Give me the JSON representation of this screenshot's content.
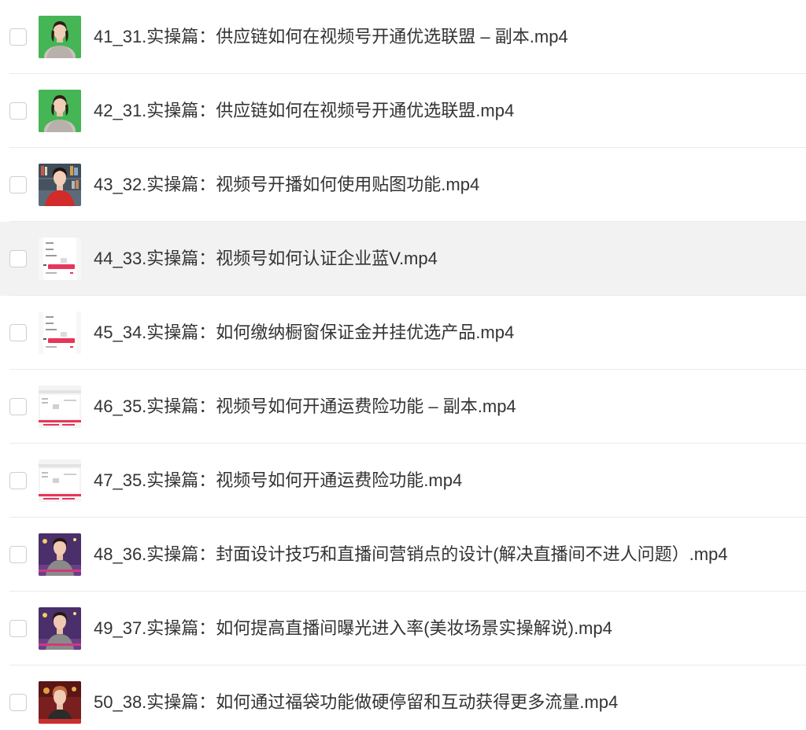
{
  "files": [
    {
      "name": "41_31.实操篇：供应链如何在视频号开通优选联盟 – 副本.mp4",
      "thumbnail": "video-thumbnail-presenter-greenscreen",
      "selected": false
    },
    {
      "name": "42_31.实操篇：供应链如何在视频号开通优选联盟.mp4",
      "thumbnail": "video-thumbnail-presenter-greenscreen",
      "selected": false
    },
    {
      "name": "43_32.实操篇：视频号开播如何使用贴图功能.mp4",
      "thumbnail": "video-thumbnail-presenter-bookshelf",
      "selected": false
    },
    {
      "name": "44_33.实操篇：视频号如何认证企业蓝V.mp4",
      "thumbnail": "video-thumbnail-phone-screen",
      "selected": false,
      "highlighted": true
    },
    {
      "name": "45_34.实操篇：如何缴纳橱窗保证金并挂优选产品.mp4",
      "thumbnail": "video-thumbnail-phone-screen",
      "selected": false
    },
    {
      "name": "46_35.实操篇：视频号如何开通运费险功能 – 副本.mp4",
      "thumbnail": "video-thumbnail-web-screen",
      "selected": false
    },
    {
      "name": "47_35.实操篇：视频号如何开通运费险功能.mp4",
      "thumbnail": "video-thumbnail-web-screen",
      "selected": false
    },
    {
      "name": "48_36.实操篇：封面设计技巧和直播间营销点的设计(解决直播间不进人问题）.mp4",
      "thumbnail": "video-thumbnail-presenter-purple",
      "selected": false
    },
    {
      "name": "49_37.实操篇：如何提高直播间曝光进入率(美妆场景实操解说).mp4",
      "thumbnail": "video-thumbnail-presenter-purple",
      "selected": false
    },
    {
      "name": "50_38.实操篇：如何通过福袋功能做硬停留和互动获得更多流量.mp4",
      "thumbnail": "video-thumbnail-presenter-red",
      "selected": false
    }
  ],
  "colors": {
    "row_highlight": "#f2f2f2",
    "divider": "#ebebeb",
    "text": "#333333",
    "checkbox_border": "#cfcfcf"
  }
}
